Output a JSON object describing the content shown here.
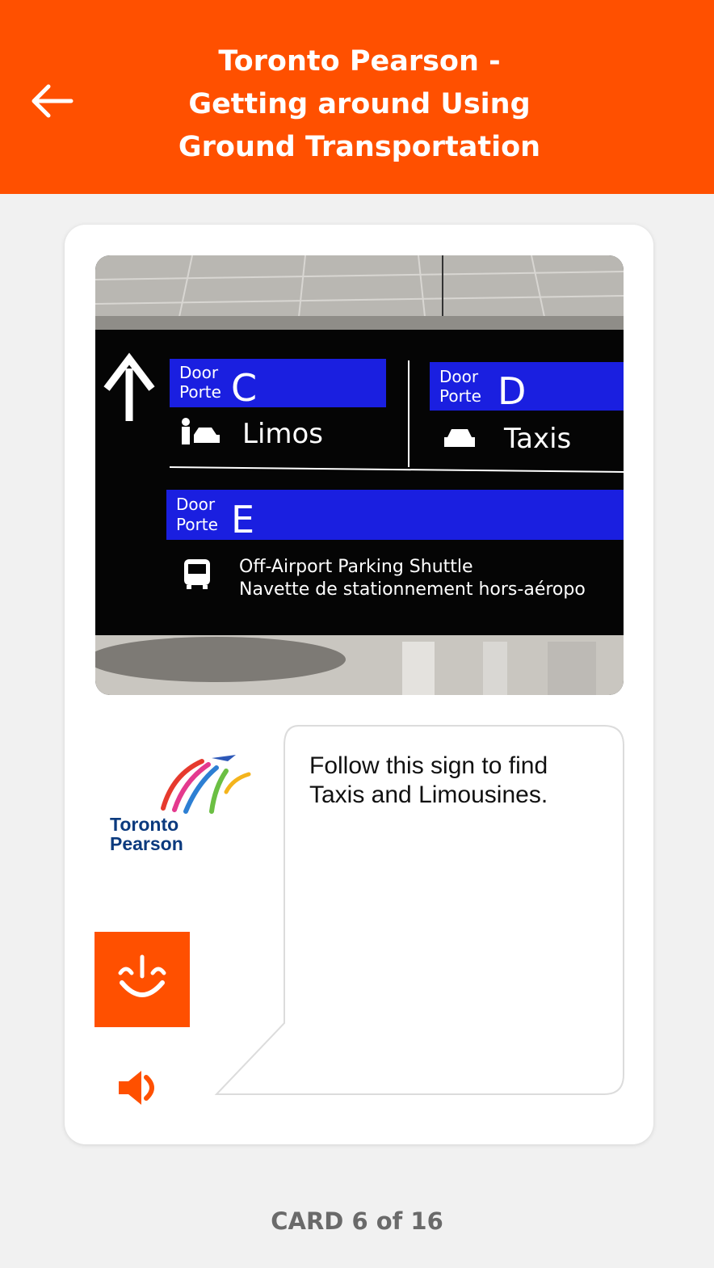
{
  "header": {
    "title_lines": [
      "Toronto Pearson -",
      "Getting around Using",
      "Ground Transportation"
    ],
    "back_icon": "arrow-left-icon",
    "bg_color": "#ff5000"
  },
  "card": {
    "photo": {
      "door_label_en": "Door",
      "door_label_fr": "Porte",
      "door_c": "C",
      "door_d": "D",
      "door_e": "E",
      "limos": "Limos",
      "taxis": "Taxis",
      "shuttle_line1": "Off-Airport Parking Shuttle",
      "shuttle_line2": "Navette de stationnement hors-aéropo"
    },
    "logo": {
      "line1": "Toronto",
      "line2": "Pearson"
    },
    "message": "Follow this sign to find Taxis and Limousines.",
    "speaker_icon": "speaker-icon"
  },
  "counter": "CARD 6 of 16"
}
